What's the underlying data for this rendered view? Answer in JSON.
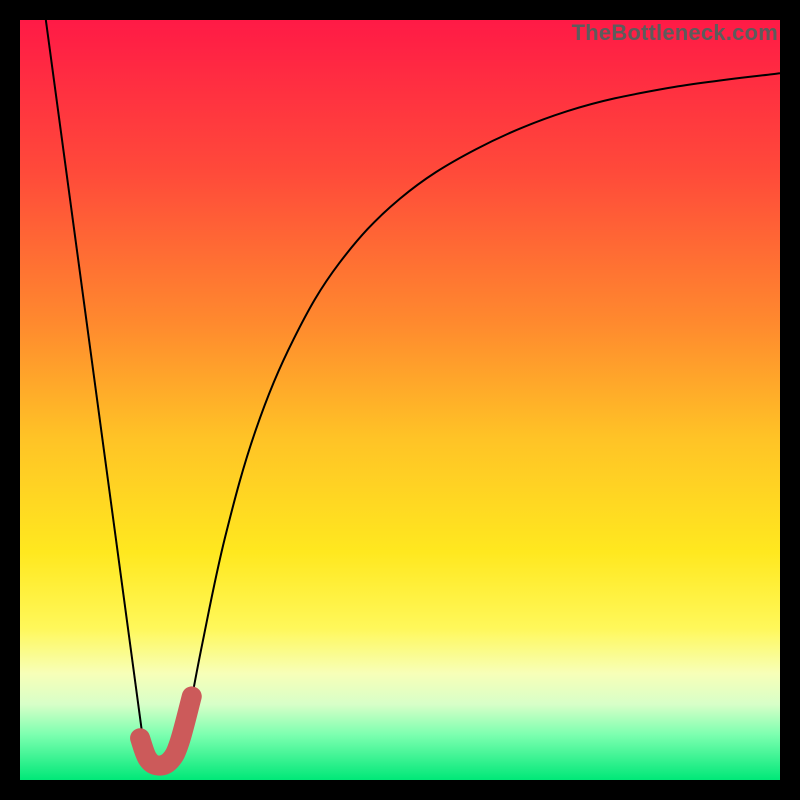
{
  "watermark": "TheBottleneck.com",
  "chart_data": {
    "type": "line",
    "title": "",
    "xlabel": "",
    "ylabel": "",
    "xlim": [
      0,
      100
    ],
    "ylim": [
      0,
      100
    ],
    "gradient_stops": [
      {
        "offset": 0,
        "color": "#ff1a46"
      },
      {
        "offset": 20,
        "color": "#ff4a3a"
      },
      {
        "offset": 40,
        "color": "#ff8a2e"
      },
      {
        "offset": 55,
        "color": "#ffc326"
      },
      {
        "offset": 70,
        "color": "#ffe81f"
      },
      {
        "offset": 80,
        "color": "#fff85a"
      },
      {
        "offset": 86,
        "color": "#f7ffb8"
      },
      {
        "offset": 90,
        "color": "#d8ffc8"
      },
      {
        "offset": 94,
        "color": "#7dffb0"
      },
      {
        "offset": 100,
        "color": "#00e878"
      }
    ],
    "series": [
      {
        "name": "left-slope",
        "stroke": "#000000",
        "width": 2.0,
        "points": [
          {
            "x": 3.4,
            "y": 100
          },
          {
            "x": 16.2,
            "y": 5.2
          }
        ]
      },
      {
        "name": "right-curve",
        "stroke": "#000000",
        "width": 2.0,
        "points": [
          {
            "x": 22.0,
            "y": 7.5
          },
          {
            "x": 24.0,
            "y": 18.0
          },
          {
            "x": 27.0,
            "y": 32.0
          },
          {
            "x": 31.0,
            "y": 46.0
          },
          {
            "x": 36.0,
            "y": 58.0
          },
          {
            "x": 42.0,
            "y": 68.0
          },
          {
            "x": 50.0,
            "y": 76.5
          },
          {
            "x": 60.0,
            "y": 83.0
          },
          {
            "x": 72.0,
            "y": 88.0
          },
          {
            "x": 85.0,
            "y": 91.0
          },
          {
            "x": 100.0,
            "y": 93.0
          }
        ]
      },
      {
        "name": "j-highlight",
        "stroke": "#cc5a5a",
        "width": 20,
        "linecap": "round",
        "points": [
          {
            "x": 15.8,
            "y": 5.5
          },
          {
            "x": 16.8,
            "y": 2.8
          },
          {
            "x": 18.2,
            "y": 1.9
          },
          {
            "x": 19.8,
            "y": 2.6
          },
          {
            "x": 21.0,
            "y": 5.0
          },
          {
            "x": 22.6,
            "y": 11.0
          }
        ]
      }
    ]
  }
}
